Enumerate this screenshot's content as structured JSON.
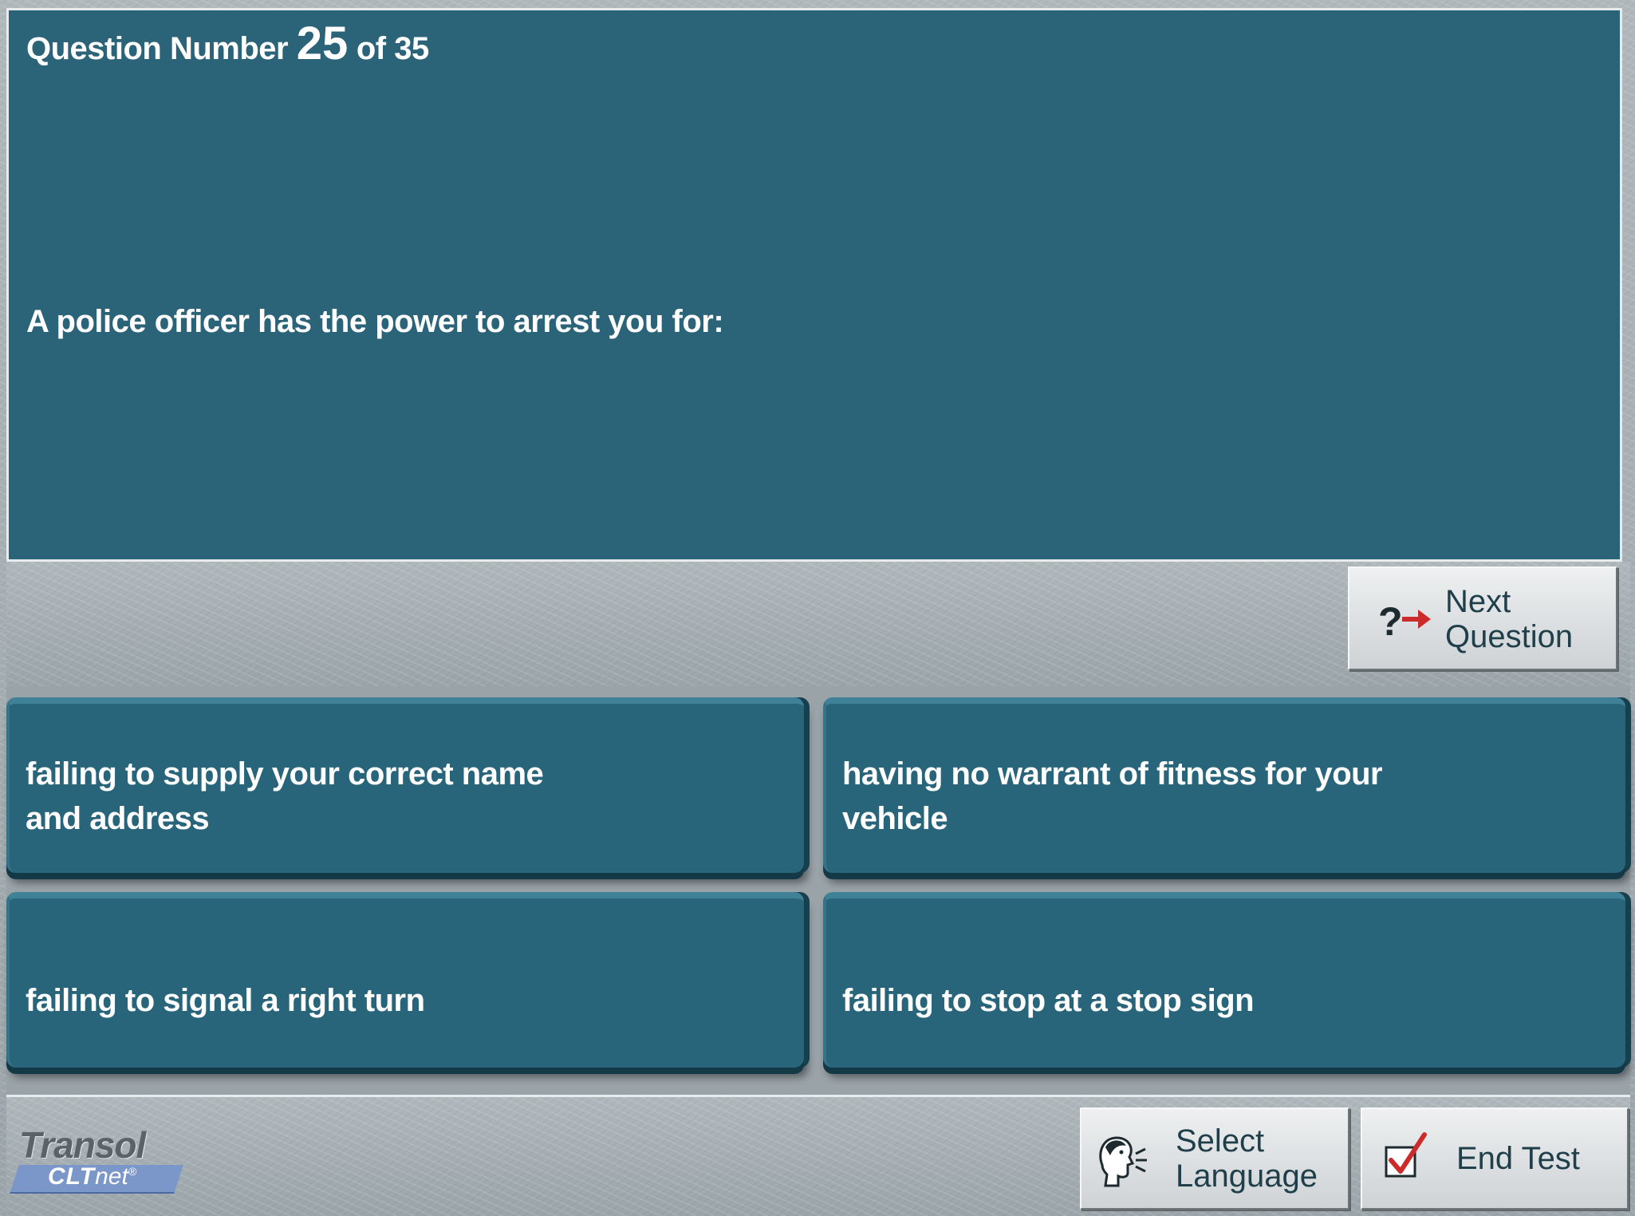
{
  "question": {
    "number_prefix": "Question Number",
    "number": "25",
    "number_suffix": "of 35",
    "text": "A police officer has the power to arrest you for:"
  },
  "answers": [
    {
      "text": "failing to supply your correct name\nand address"
    },
    {
      "text": "having no warrant of fitness for your\nvehicle"
    },
    {
      "text": "failing to signal a right turn"
    },
    {
      "text": "failing to stop at a stop sign"
    }
  ],
  "buttons": {
    "next_question": "Next\nQuestion",
    "select_language": "Select\nLanguage",
    "end_test": "End Test"
  },
  "logo": {
    "top": "Transol",
    "sub_bold": "CLT",
    "sub_rest": "net",
    "registered": "®"
  },
  "colors": {
    "panel": "#2b6479",
    "answer_tile": "#29657a",
    "arrow_red": "#cc2b2b",
    "check_red": "#cc2b2b",
    "logo_blue": "#7b96c9"
  },
  "icons": {
    "next_question": "question-arrow-icon",
    "select_language": "speaking-head-icon",
    "end_test": "checkbox-check-icon"
  }
}
